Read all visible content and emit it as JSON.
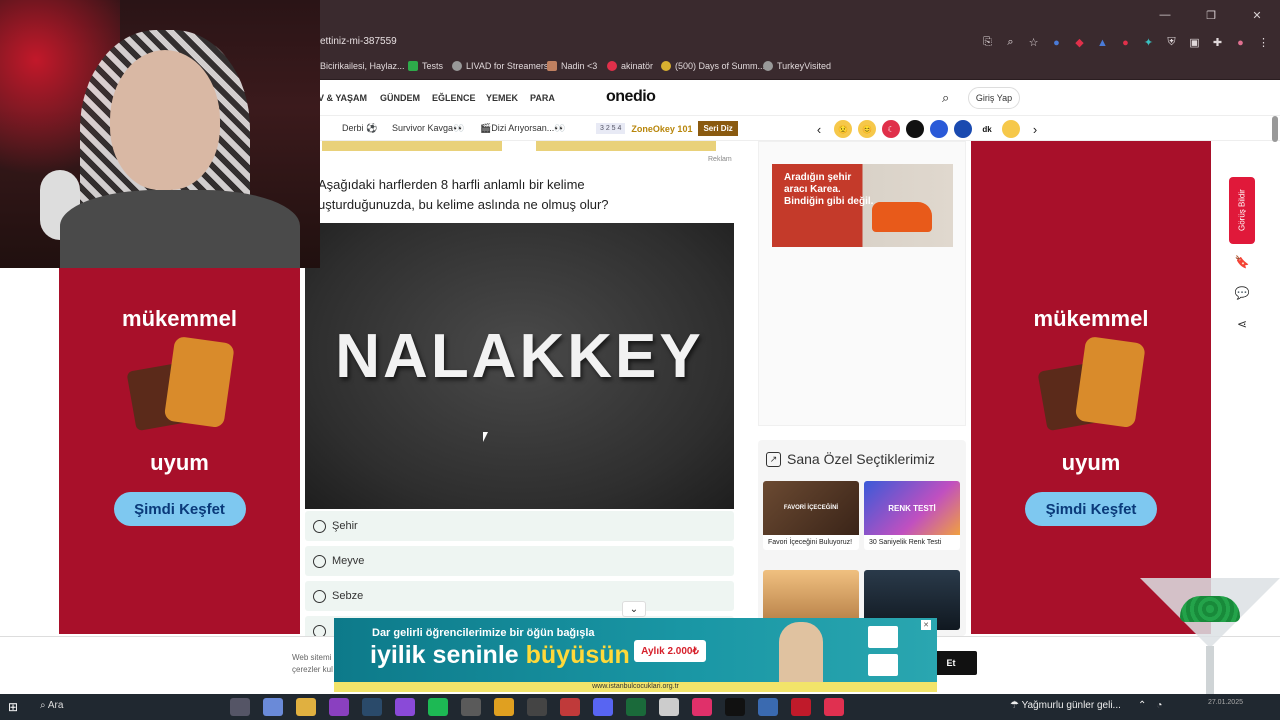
{
  "browser": {
    "url": "ettiniz-mi-387559",
    "bookmarks": [
      "Bicirikailesi, Haylaz...",
      "Tests",
      "LIVAD for Streamers",
      "Nadin <3",
      "akinatör",
      "(500) Days of Summ...",
      "TurkeyVisited"
    ]
  },
  "site": {
    "nav": [
      "V & YAŞAM",
      "GÜNDEM",
      "EĞLENCE",
      "YEMEK",
      "PARA"
    ],
    "logo": "onedio",
    "login": "Giriş Yap",
    "subnav": [
      "Derbi ⚽",
      "Survivor Kavga👀",
      "🎬Dizi Arıyorsan...👀"
    ],
    "zone_nums": "3 2 5 4",
    "zone_title": "ZoneOkey 101",
    "zone_badge": "Seri Diz",
    "emoji_chevron_left": "‹",
    "emoji_chevron_right": "›"
  },
  "article": {
    "reklam": "Reklam",
    "question_line1": "Aşağıdaki harflerden 8 harfli anlamlı bir kelime",
    "question_line2": "uşturduğunuzda, bu kelime aslında ne olmuş olur?",
    "board_word": "NALAKKEY",
    "options": [
      "Şehir",
      "Meyve",
      "Sebze"
    ]
  },
  "side_ads": {
    "headline": "mükemmel",
    "tagline": "uyum",
    "cta": "Şimdi Keşfet"
  },
  "karea": {
    "text": "Aradığın şehir aracı Karea. Bindiğin gibi değil."
  },
  "picks": {
    "title": "Sana Özel Seçtiklerimiz",
    "cards": [
      {
        "caption": "Favori İçeceğini Buluyoruz!",
        "img_text": "FAVORİ İÇECEĞİNİ"
      },
      {
        "caption": "30 Saniyelik Renk Testi",
        "img_text": "RENK TESTİ"
      }
    ]
  },
  "feedback": "Görüş Bildir",
  "cookie": {
    "text": "Web sitemi çerezler kul",
    "button": "Et"
  },
  "bottom_ad": {
    "line1": "Dar gelirli öğrencilerimize bir öğün bağışla",
    "line2_a": "iyilik seninle ",
    "line2_b": "büyüsün",
    "pill": "Aylık 2.000₺",
    "source": "www.istanbulcocuklari.org.tr"
  },
  "taskbar": {
    "search": "Ara",
    "weather": "Yağmurlu günler geli...",
    "date": "27.01.2025"
  }
}
